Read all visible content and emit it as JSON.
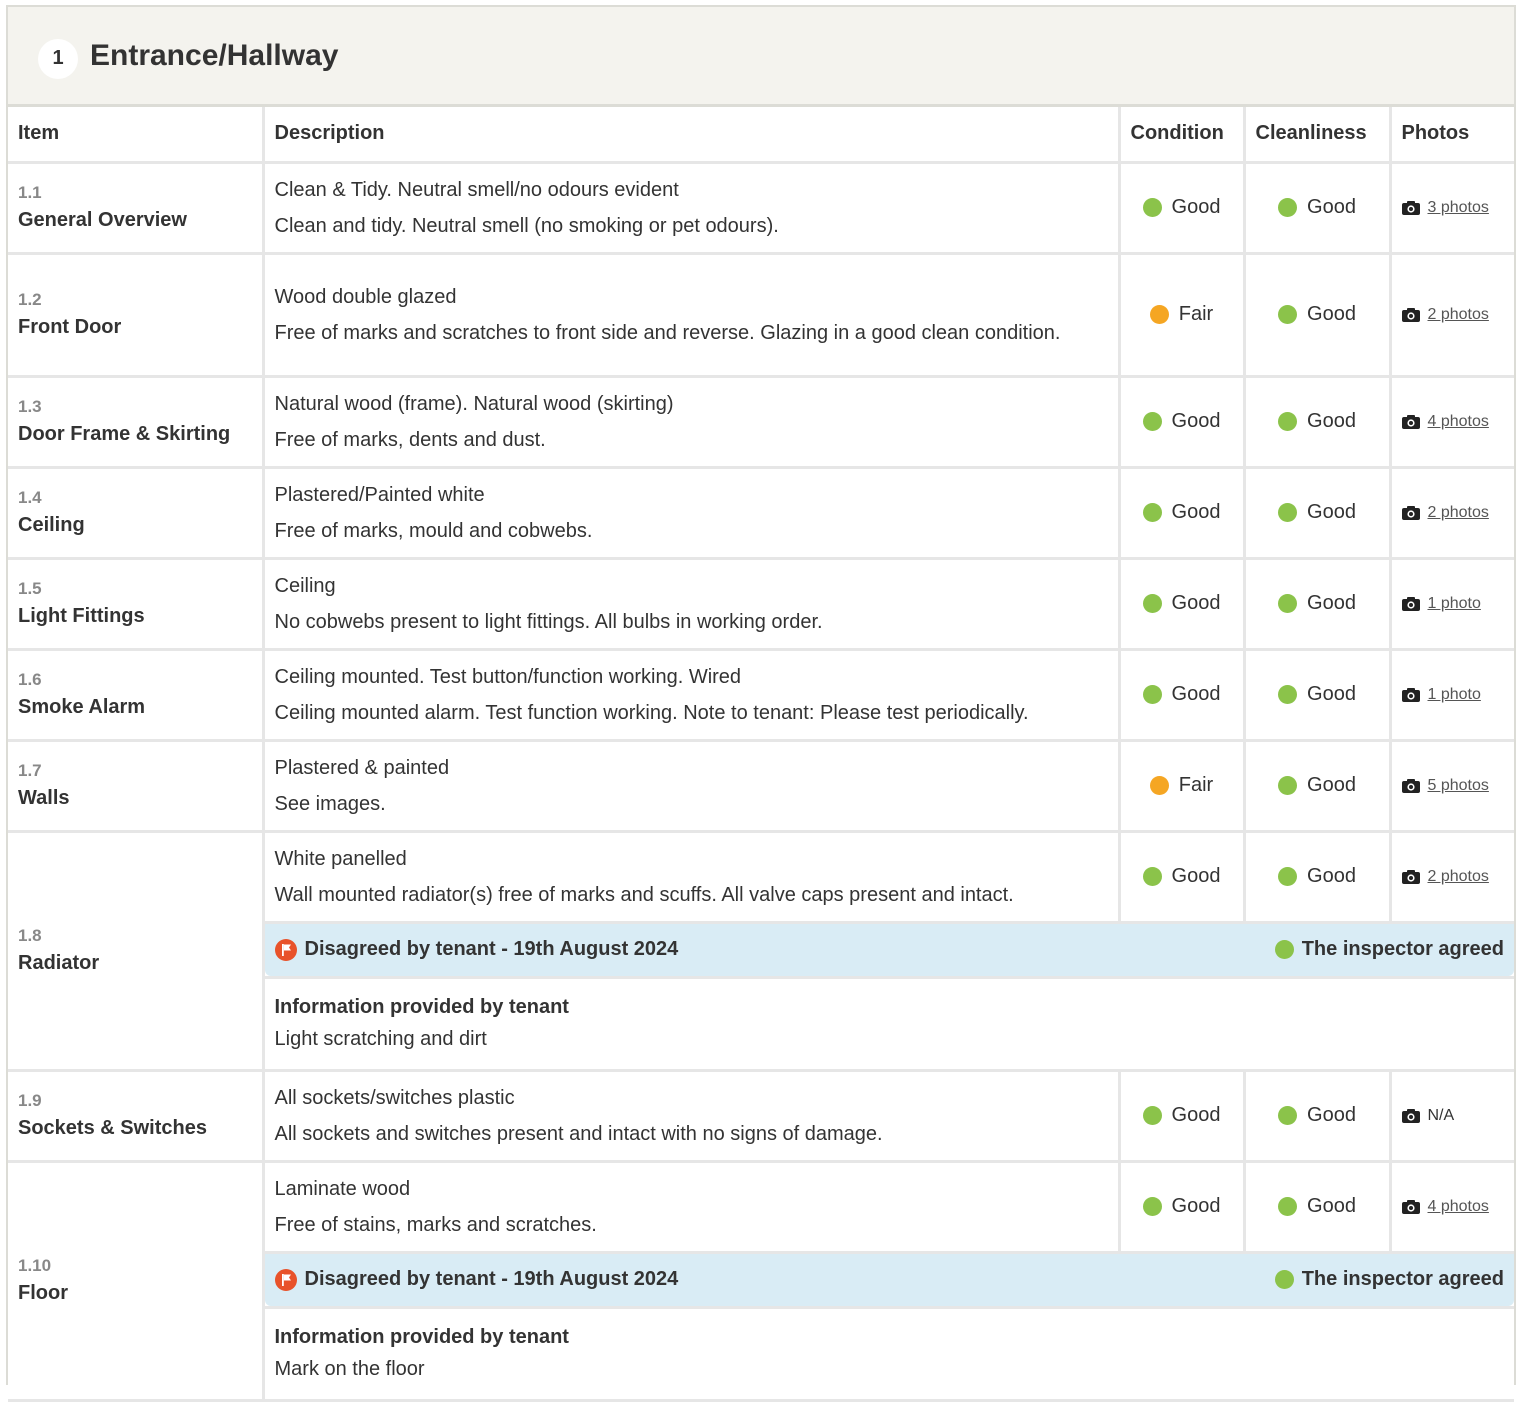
{
  "section": {
    "number": "1",
    "title": "Entrance/Hallway"
  },
  "headers": {
    "item": "Item",
    "description": "Description",
    "condition": "Condition",
    "cleanliness": "Cleanliness",
    "photos": "Photos"
  },
  "items": [
    {
      "num": "1.1",
      "name": "General Overview",
      "lines": [
        "Clean & Tidy. Neutral smell/no odours evident",
        "Clean and tidy. Neutral smell (no smoking or pet odours)."
      ],
      "condition": "Good",
      "cleanliness": "Good",
      "photos": "3 photos"
    },
    {
      "num": "1.2",
      "name": "Front Door",
      "lines": [
        "Wood double glazed",
        "Free of marks and scratches to front side and reverse. Glazing in a good clean condition."
      ],
      "condition": "Fair",
      "cleanliness": "Good",
      "photos": "2 photos"
    },
    {
      "num": "1.3",
      "name": "Door Frame & Skirting",
      "lines": [
        "Natural wood (frame). Natural wood (skirting)",
        "Free of marks, dents and dust."
      ],
      "condition": "Good",
      "cleanliness": "Good",
      "photos": "4 photos"
    },
    {
      "num": "1.4",
      "name": "Ceiling",
      "lines": [
        "Plastered/Painted white",
        "Free of marks, mould and cobwebs."
      ],
      "condition": "Good",
      "cleanliness": "Good",
      "photos": "2 photos"
    },
    {
      "num": "1.5",
      "name": "Light Fittings",
      "lines": [
        "Ceiling",
        "No cobwebs present to light fittings. All bulbs in working order."
      ],
      "condition": "Good",
      "cleanliness": "Good",
      "photos": "1 photo"
    },
    {
      "num": "1.6",
      "name": "Smoke Alarm",
      "lines": [
        "Ceiling mounted. Test button/function working. Wired",
        "Ceiling mounted alarm. Test function working. Note to tenant: Please test periodically."
      ],
      "condition": "Good",
      "cleanliness": "Good",
      "photos": "1 photo"
    },
    {
      "num": "1.7",
      "name": "Walls",
      "lines": [
        "Plastered & painted",
        "See images."
      ],
      "condition": "Fair",
      "cleanliness": "Good",
      "photos": "5 photos"
    },
    {
      "num": "1.8",
      "name": "Radiator",
      "lines": [
        "White panelled",
        "Wall mounted radiator(s) free of marks and scuffs. All valve caps present and intact."
      ],
      "condition": "Good",
      "cleanliness": "Good",
      "photos": "2 photos",
      "dispute": {
        "label": "Disagreed by tenant - 19th August 2024",
        "resolution": "The inspector agreed",
        "info_title": "Information provided by tenant",
        "info_text": "Light scratching and dirt"
      }
    },
    {
      "num": "1.9",
      "name": "Sockets & Switches",
      "lines": [
        "All sockets/switches plastic",
        "All sockets and switches present and intact with no signs of damage."
      ],
      "condition": "Good",
      "cleanliness": "Good",
      "photos": "N/A"
    },
    {
      "num": "1.10",
      "name": "Floor",
      "lines": [
        "Laminate wood",
        "Free of stains, marks and scratches."
      ],
      "condition": "Good",
      "cleanliness": "Good",
      "photos": "4 photos",
      "dispute": {
        "label": "Disagreed by tenant - 19th August 2024",
        "resolution": "The inspector agreed",
        "info_title": "Information provided by tenant",
        "info_text": "Mark on the floor"
      }
    }
  ],
  "colors": {
    "good": "#8bc34a",
    "fair": "#f5a623",
    "flag": "#e8522a",
    "dispute_bg": "#d9ecf5",
    "header_bg": "#f4f3ee"
  },
  "icons": {
    "photo": "camera-icon",
    "dispute": "flag-icon",
    "status": "status-dot-icon"
  }
}
